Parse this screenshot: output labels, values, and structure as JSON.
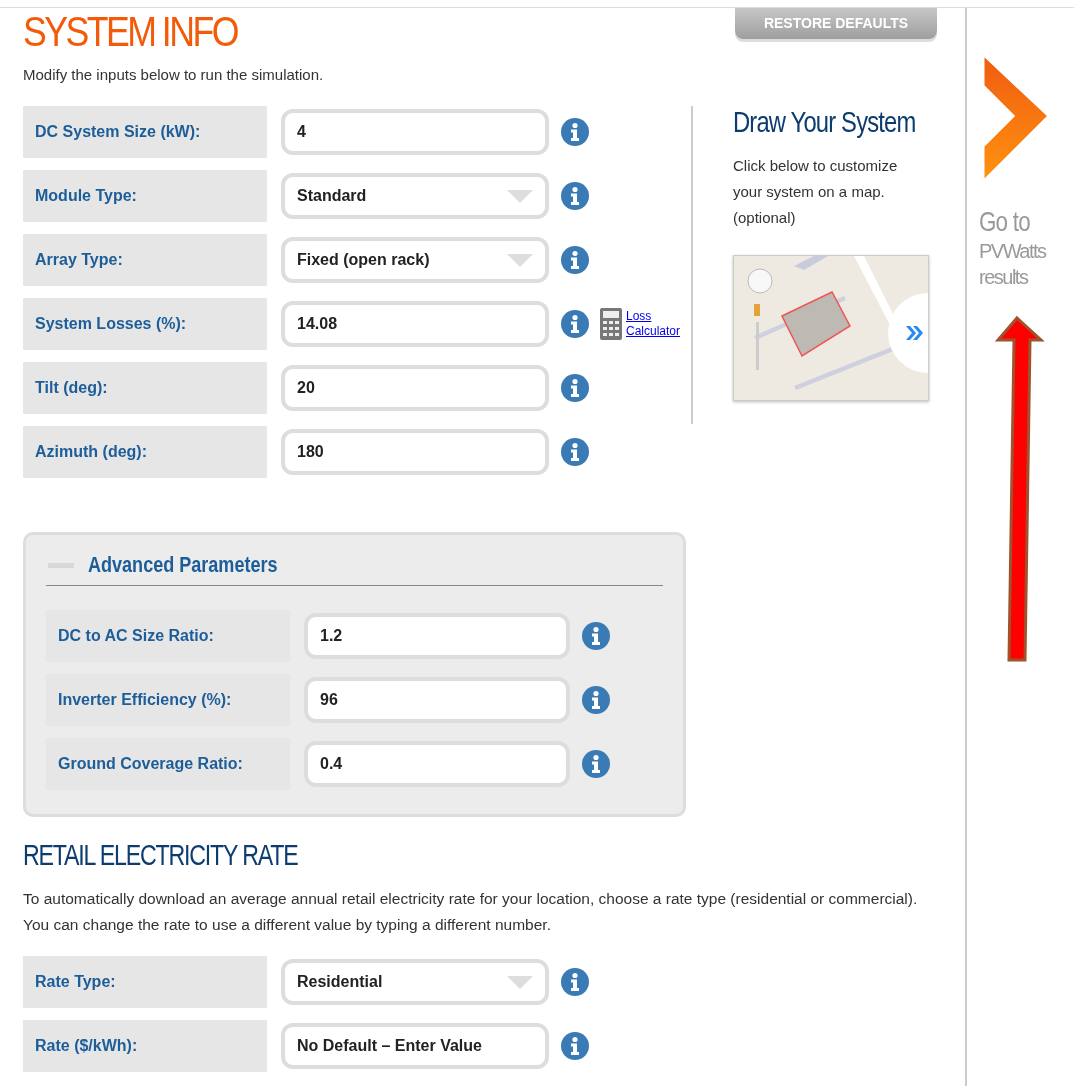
{
  "header": {
    "title": "SYSTEM INFO",
    "restore_button": "RESTORE DEFAULTS",
    "intro": "Modify the inputs below to run the simulation."
  },
  "fields": [
    {
      "label": "DC System Size (kW):",
      "value": "4",
      "kind": "text"
    },
    {
      "label": "Module Type:",
      "value": "Standard",
      "kind": "select"
    },
    {
      "label": "Array Type:",
      "value": "Fixed (open rack)",
      "kind": "select"
    },
    {
      "label": "System Losses (%):",
      "value": "14.08",
      "kind": "text",
      "link": "Loss Calculator"
    },
    {
      "label": "Tilt (deg):",
      "value": "20",
      "kind": "text"
    },
    {
      "label": "Azimuth (deg):",
      "value": "180",
      "kind": "text"
    }
  ],
  "draw": {
    "title": "Draw Your System",
    "text": "Click below to customize your system on a map. (optional)"
  },
  "advanced": {
    "title": "Advanced Parameters",
    "fields": [
      {
        "label": "DC to AC Size Ratio:",
        "value": "1.2",
        "kind": "text"
      },
      {
        "label": "Inverter Efficiency (%):",
        "value": "96",
        "kind": "text"
      },
      {
        "label": "Ground Coverage Ratio:",
        "value": "0.4",
        "kind": "text"
      }
    ]
  },
  "retail": {
    "title": "RETAIL ELECTRICITY RATE",
    "text": "To automatically download an average annual retail electricity rate for your location, choose a rate type (residential or commercial). You can change the rate to use a different value by typing a different number.",
    "fields": [
      {
        "label": "Rate Type:",
        "value": "Residential",
        "kind": "select"
      },
      {
        "label": "Rate ($/kWh):",
        "value": "No Default – Enter Value",
        "kind": "text"
      }
    ]
  },
  "sidebar": {
    "title": "Go to",
    "subtitle": "PVWatts results"
  }
}
